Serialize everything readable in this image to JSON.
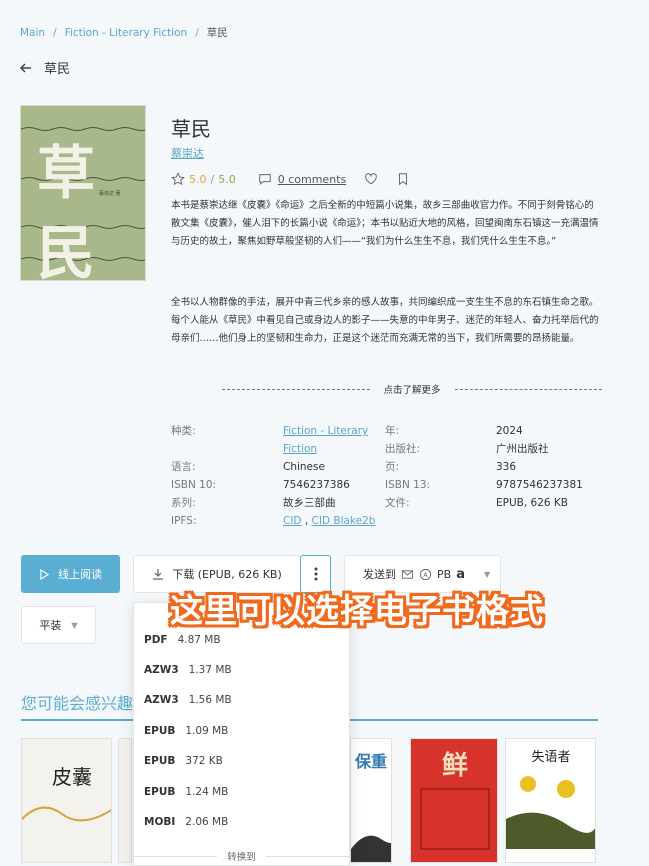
{
  "breadcrumb": [
    "Main",
    "Fiction - Literary Fiction",
    "草民"
  ],
  "back_label": "草民",
  "cover": {
    "big1": "草",
    "big2": "民",
    "author": "蔡崇达 著"
  },
  "book": {
    "title": "草民",
    "author": "蔡崇达",
    "rating_a": "5.0",
    "rating_b": "5.0",
    "comments": "0 comments"
  },
  "description": {
    "p1": "本书是蔡崇达继《皮囊》《命运》之后全新的中短篇小说集，故乡三部曲收官力作。不同于刻骨铭心的散文集《皮囊》，催人泪下的长篇小说《命运》；本书以贴近大地的风格，回望闽南东石镇这一充满温情与历史的故土，聚焦如野草般坚韧的人们——“我们为什么生生不息，我们凭什么生生不息。”",
    "p2": "全书以人物群像的手法，展开中青三代乡亲的感人故事，共同编织成一支生生不息的东石镇生命之歌。每个人能从《草民》中看见自己或身边人的影子——失意的中年男子、迷茫的年轻人、奋力托举后代的母亲们……他们身上的坚韧和生命力，正是这个迷茫而充满无常的当下，我们所需要的昂扬能量。"
  },
  "more_label": "点击了解更多",
  "details": {
    "category_label": "种类:",
    "category_val1": "Fiction - Literary",
    "category_val2": "Fiction",
    "language_label": "语言:",
    "language_val": "Chinese",
    "isbn10_label": "ISBN 10:",
    "isbn10_val": "7546237386",
    "series_label": "系列:",
    "series_val": "故乡三部曲",
    "ipfs_label": "IPFS:",
    "ipfs_cid": "CID",
    "ipfs_blake": "CID Blake2b",
    "year_label": "年:",
    "year_val": "2024",
    "publisher_label": "出版社:",
    "publisher_val": "广州出版社",
    "pages_label": "页:",
    "pages_val": "336",
    "isbn13_label": "ISBN 13:",
    "isbn13_val": "9787546237381",
    "file_label": "文件:",
    "file_val": "EPUB, 626 KB"
  },
  "actions": {
    "read": "线上阅读",
    "download": "下载 (EPUB, 626 KB)",
    "send": "发送到",
    "send_pb": "PB",
    "send_amz": "a",
    "binding": "平装"
  },
  "banner": "这里可以选择电子书格式",
  "recommend_title": "您可能会感兴趣",
  "formats": [
    {
      "format": "PDF",
      "size": "4.87 MB"
    },
    {
      "format": "AZW3",
      "size": "1.37 MB"
    },
    {
      "format": "AZW3",
      "size": "1.56 MB"
    },
    {
      "format": "EPUB",
      "size": "1.09 MB"
    },
    {
      "format": "EPUB",
      "size": "372 KB"
    },
    {
      "format": "EPUB",
      "size": "1.24 MB"
    },
    {
      "format": "MOBI",
      "size": "2.06 MB"
    }
  ],
  "convert_label": "转换到",
  "recommend_books": [
    {
      "title": "皮囊",
      "bg": "#f4f2ec"
    },
    {
      "title": "保重",
      "bg": "#ffffff"
    },
    {
      "title": "鲜",
      "bg": "#d8322c"
    },
    {
      "title": "失语者",
      "bg": "#ffffff"
    }
  ],
  "colors": {
    "accent": "#5aaed2",
    "banner_stroke": "#f06a1d",
    "cover_bg": "#a9b88a"
  }
}
